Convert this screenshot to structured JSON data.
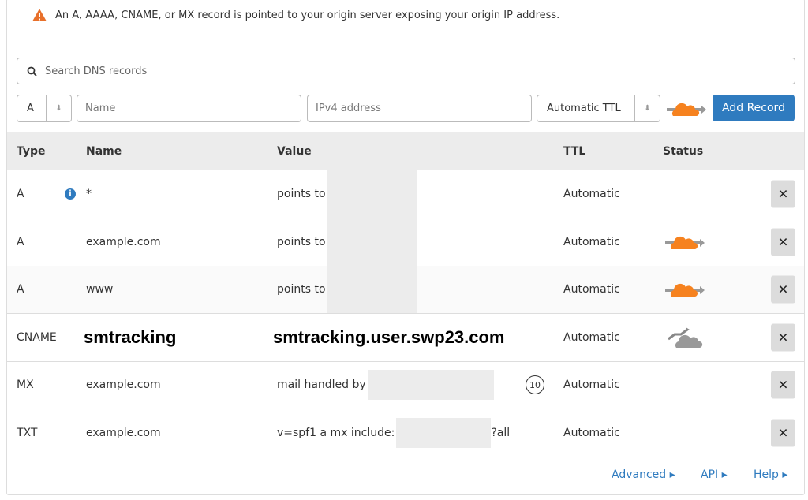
{
  "warning": {
    "icon": "warning-triangle-icon",
    "text": "An A, AAAA, CNAME, or MX record is pointed to your origin server exposing your origin IP address."
  },
  "search": {
    "placeholder": "Search DNS records"
  },
  "form": {
    "type": "A",
    "name_placeholder": "Name",
    "value_placeholder": "IPv4 address",
    "ttl": "Automatic TTL",
    "proxy_status": "proxied",
    "add_label": "Add Record"
  },
  "colors": {
    "accent": "#2f7bbf",
    "proxied": "#f6821f",
    "dns_only": "#999999",
    "warning": "#e8702a"
  },
  "table": {
    "headers": [
      "Type",
      "Name",
      "Value",
      "TTL",
      "Status"
    ],
    "rows": [
      {
        "type": "A",
        "name": "*",
        "value": "points to",
        "ttl": "Automatic",
        "status": "none",
        "info": true
      },
      {
        "type": "A",
        "name": "example.com",
        "value": "points to",
        "ttl": "Automatic",
        "status": "proxied"
      },
      {
        "type": "A",
        "name": "www",
        "value": "points to",
        "ttl": "Automatic",
        "status": "proxied"
      },
      {
        "type": "CNAME",
        "name": "smtracking",
        "value": "smtracking.user.swp23.com",
        "ttl": "Automatic",
        "status": "dns-only"
      },
      {
        "type": "MX",
        "name": "example.com",
        "value": "mail handled by",
        "priority": "10",
        "ttl": "Automatic",
        "status": "none"
      },
      {
        "type": "TXT",
        "name": "example.com",
        "value": "v=spf1 a mx include:",
        "value_suffix": "?all",
        "ttl": "Automatic",
        "status": "none"
      }
    ]
  },
  "footer": {
    "advanced": "Advanced ▸",
    "api": "API ▸",
    "help": "Help ▸"
  }
}
